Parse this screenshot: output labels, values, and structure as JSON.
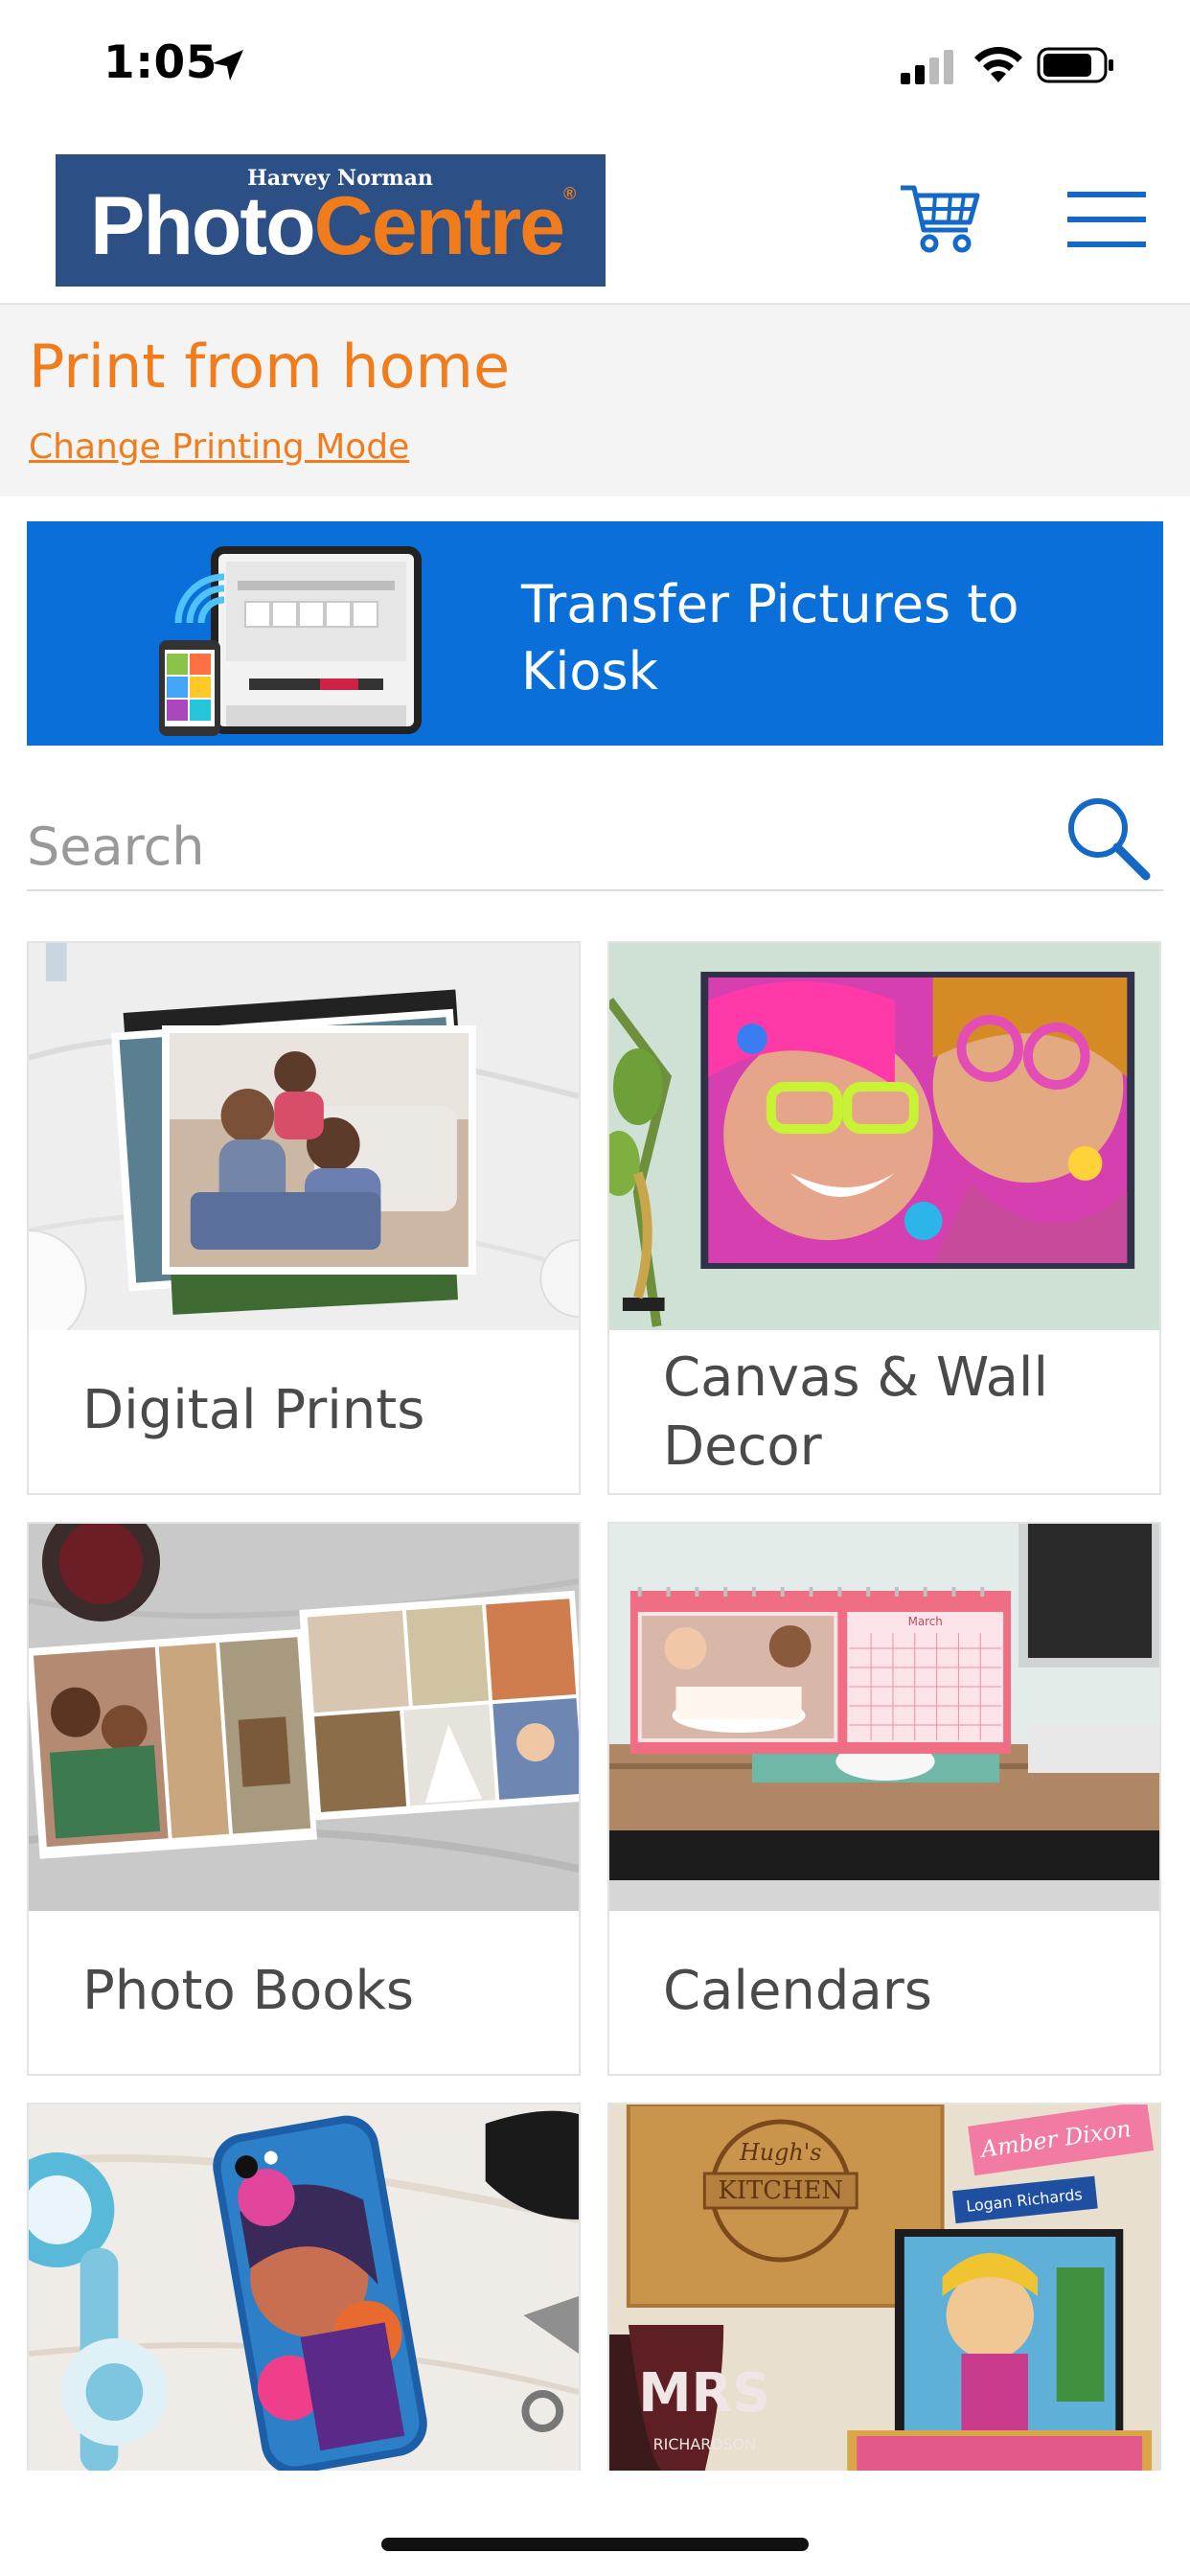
{
  "status_bar": {
    "time": "1:05",
    "icons": [
      "location-arrow-icon",
      "cellular-signal-icon",
      "wifi-icon",
      "battery-icon"
    ]
  },
  "header": {
    "logo": {
      "top_text": "Harvey Norman",
      "word1": "Photo",
      "word2": "Centre",
      "reg": "®"
    },
    "cart_icon": "shopping-cart-icon",
    "menu_icon": "hamburger-menu-icon"
  },
  "mode": {
    "title": "Print from home",
    "change_link": "Change Printing Mode"
  },
  "kiosk_banner": {
    "label": "Transfer Pictures to Kiosk",
    "icon": "kiosk-transfer-illustration"
  },
  "search": {
    "placeholder": "Search",
    "value": "",
    "icon": "search-icon"
  },
  "products": [
    {
      "label": "Digital Prints",
      "image": "family-photo-prints"
    },
    {
      "label": "Canvas & Wall Decor",
      "image": "colorful-canvas-selfie"
    },
    {
      "label": "Photo Books",
      "image": "open-photo-book"
    },
    {
      "label": "Calendars",
      "image": "desk-calendar"
    },
    {
      "label": "",
      "image": "custom-phone-case"
    },
    {
      "label": "",
      "image": "personalised-gifts"
    }
  ],
  "colors": {
    "brand_blue": "#2c4f86",
    "brand_orange": "#f07c1b",
    "banner_blue": "#0a6fd9",
    "icon_blue": "#1469c7"
  }
}
